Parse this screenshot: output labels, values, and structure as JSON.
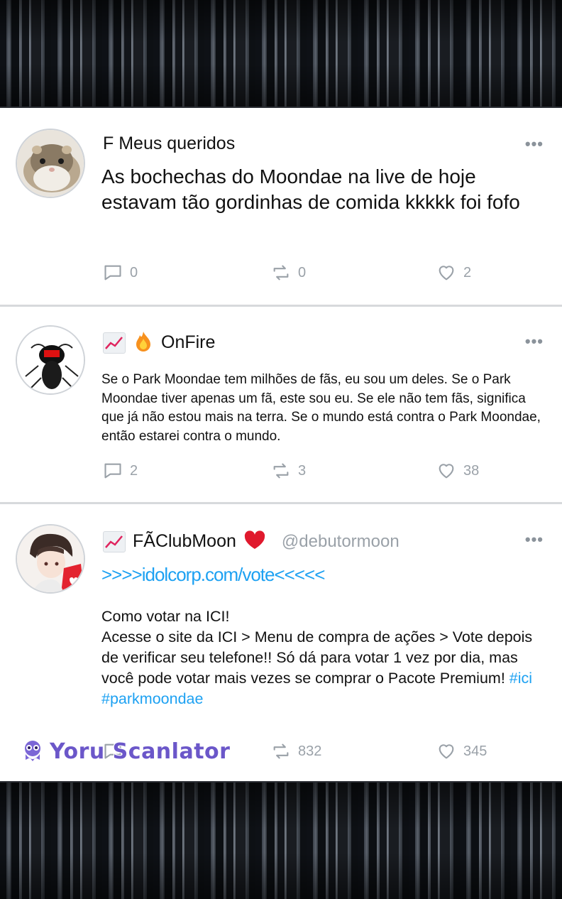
{
  "tweets": [
    {
      "name": "F Meus queridos",
      "avatar_icon": "hamster-avatar",
      "text": "As bochechas do Moondae na live de hoje estavam tão gordinhas de comida kkkkk foi fofo",
      "replies": "0",
      "retweets": "0",
      "likes": "2"
    },
    {
      "name": "OnFire",
      "name_icons": [
        "chart-increasing-emoji",
        "fire-emoji"
      ],
      "avatar_icon": "ant-avatar",
      "text": "Se o Park Moondae tem milhões de fãs, eu sou um deles. Se o Park Moondae tiver apenas um fã, este sou eu. Se ele não tem fãs, significa que já não estou mais na terra. Se o mundo está contra o Park Moondae, então estarei contra o mundo.",
      "replies": "2",
      "retweets": "3",
      "likes": "38"
    },
    {
      "name": "FÃClubMoon",
      "name_icons": [
        "chart-increasing-emoji",
        "red-heart-emoji"
      ],
      "handle": "@debutormoon",
      "avatar_icon": "idol-avatar",
      "link": ">>>>idolcorp.com/vote<<<<<",
      "line1": "Como votar na ICI!",
      "body": "Acesse o site da ICI > Menu de compra de ações > Vote depois de verificar seu telefone!! Só dá para votar 1 vez por dia, mas você pode votar mais vezes se comprar o Pacote Premium!",
      "tags": [
        "#ici",
        "#parkmoondae"
      ],
      "retweets": "832",
      "likes": "345"
    }
  ],
  "more_glyph": "•••",
  "watermark": "Yoru Scanlator",
  "colors": {
    "link": "#1da1f2",
    "muted": "#9aa1a8",
    "heart": "#e0245e"
  }
}
